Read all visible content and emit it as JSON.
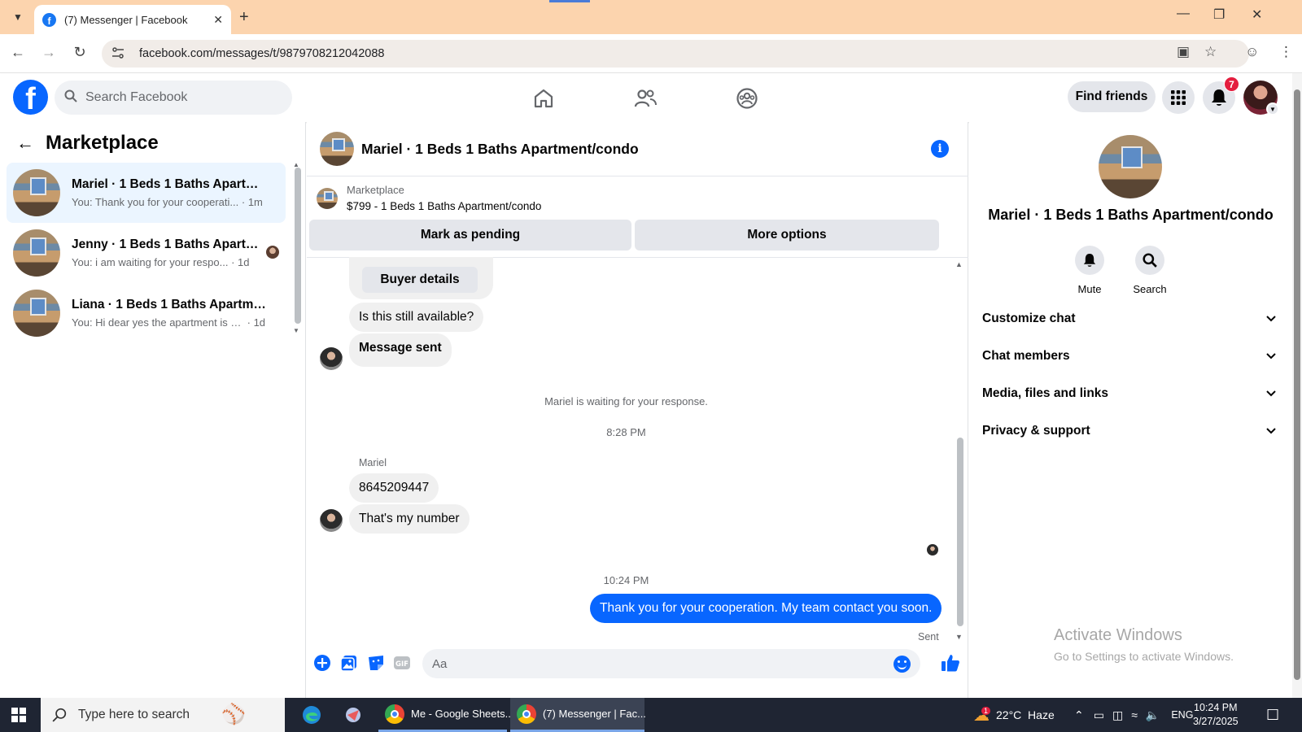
{
  "browser": {
    "tab_title": "(7) Messenger | Facebook",
    "url": "facebook.com/messages/t/9879708212042088"
  },
  "fb_header": {
    "search_placeholder": "Search Facebook",
    "find_friends": "Find friends",
    "notification_count": "7"
  },
  "left_panel": {
    "title": "Marketplace",
    "conversations": [
      {
        "name": "Mariel · 1 Beds 1 Baths Apartme...",
        "snippet": "You: Thank you for your cooperati...",
        "time": "· 1m"
      },
      {
        "name": "Jenny · 1 Beds 1 Baths Apartm...",
        "snippet": "You: i am waiting for your respo...",
        "time": "· 1d"
      },
      {
        "name": "Liana · 1 Beds 1 Baths Apartment...",
        "snippet": "You: Hi dear yes the apartment is st...",
        "time": "· 1d"
      }
    ]
  },
  "chat": {
    "title": "Mariel · 1 Beds 1 Baths Apartment/condo",
    "marketplace_label": "Marketplace",
    "listing": "$799 - 1 Beds 1 Baths Apartment/condo",
    "mark_pending": "Mark as pending",
    "more_options": "More options",
    "buyer_details": "Buyer details",
    "msg_available": "Is this still available?",
    "msg_sent": "Message sent",
    "waiting": "Mariel is waiting for your response.",
    "time1": "8:28 PM",
    "sender": "Mariel",
    "msg_number": "8645209447",
    "msg_thats": "That's my number",
    "time2": "10:24 PM",
    "msg_mine": "Thank you for your cooperation. My team contact you soon.",
    "sent_status": "Sent",
    "composer_placeholder": "Aa"
  },
  "right_panel": {
    "name": "Mariel · 1 Beds 1 Baths Apartment/condo",
    "mute": "Mute",
    "search": "Search",
    "sections": [
      "Customize chat",
      "Chat members",
      "Media, files and links",
      "Privacy & support"
    ],
    "activate_title": "Activate Windows",
    "activate_sub": "Go to Settings to activate Windows."
  },
  "taskbar": {
    "search_placeholder": "Type here to search",
    "app1": "Me - Google Sheets...",
    "app2": "(7) Messenger | Fac...",
    "weather": "22°C  Haze",
    "weather_badge": "1",
    "lang": "ENG",
    "time": "10:24 PM",
    "date": "3/27/2025"
  },
  "colors": {
    "fb_blue": "#0866ff",
    "chrome_tab": "#fcd4ae",
    "taskbar": "#1f2533"
  }
}
